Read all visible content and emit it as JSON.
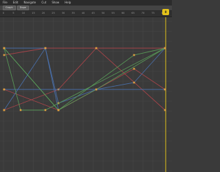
{
  "menu": {
    "items": [
      "File",
      "Edit",
      "Navigate",
      "Cut",
      "Show",
      "Help"
    ]
  },
  "toolbar": {
    "buttons": [
      "Graph",
      "Dope"
    ]
  },
  "ruler": {
    "ticks": [
      "0",
      "5",
      "10",
      "15",
      "20",
      "25",
      "30",
      "35",
      "40",
      "45",
      "50",
      "55",
      "60",
      "65",
      "70",
      "75",
      "80"
    ]
  },
  "playhead": {
    "frame": "0"
  },
  "colors": {
    "background": "#3a3a3a",
    "grid": "#474747",
    "curve_red": "#b0454a",
    "curve_green": "#5aa05a",
    "curve_blue": "#4a72b0",
    "key_orange": "#e0a040",
    "playhead": "#e3c21a"
  }
}
